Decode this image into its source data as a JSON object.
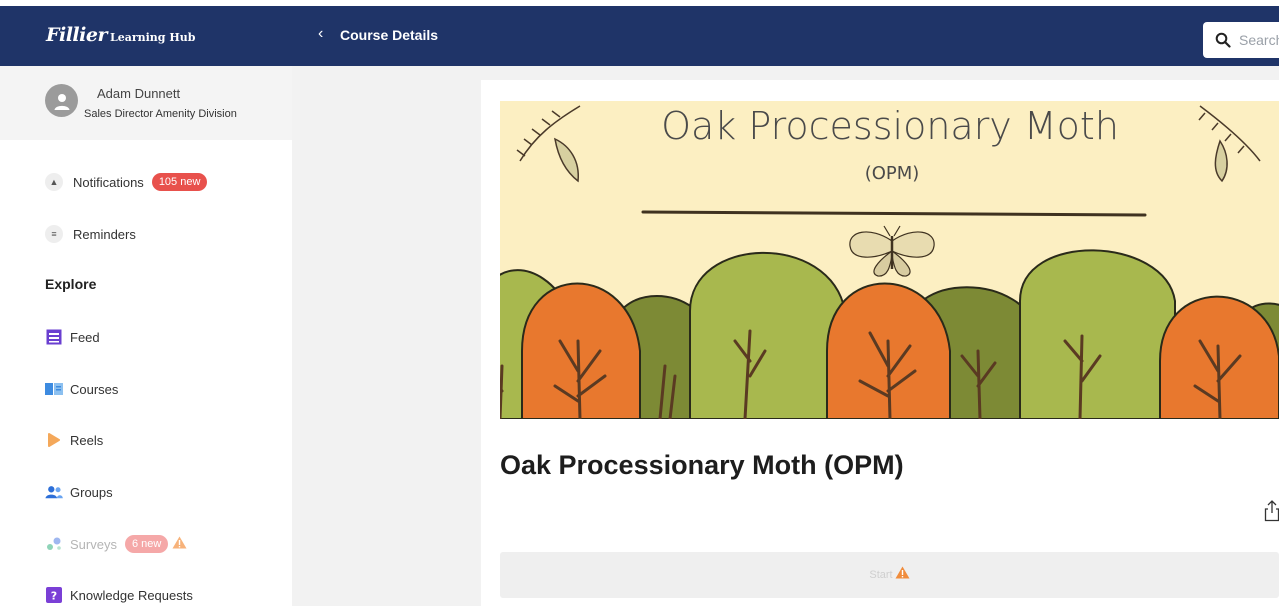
{
  "header": {
    "logo_text": "Fillier",
    "logo_sub": "Learning Hub",
    "title": "Course Details",
    "search_placeholder": "Search"
  },
  "user": {
    "name": "Adam Dunnett",
    "role": "Sales Director Amenity Division"
  },
  "sidebar": {
    "notifications": {
      "label": "Notifications",
      "badge": "105 new"
    },
    "reminders": {
      "label": "Reminders"
    },
    "explore_heading": "Explore",
    "items": [
      {
        "label": "Feed",
        "icon": "feed-icon"
      },
      {
        "label": "Courses",
        "icon": "book-icon"
      },
      {
        "label": "Reels",
        "icon": "reels-icon"
      },
      {
        "label": "Groups",
        "icon": "group-icon"
      },
      {
        "label": "Surveys",
        "icon": "survey-icon",
        "badge": "6 new"
      },
      {
        "label": "Knowledge Requests",
        "icon": "question-icon"
      }
    ]
  },
  "course": {
    "banner_title": "Oak Processionary Moth",
    "banner_subtitle": "(OPM)",
    "title": "Oak Processionary Moth (OPM)",
    "start_label": "Start"
  },
  "colors": {
    "header": "#1f3468",
    "badge": "#e8514c",
    "banner_bg": "#fcefc2",
    "tree_orange": "#e8782e",
    "tree_green": "#a8b84e",
    "tree_olive": "#7d8a35",
    "warning": "#f08c3c"
  }
}
